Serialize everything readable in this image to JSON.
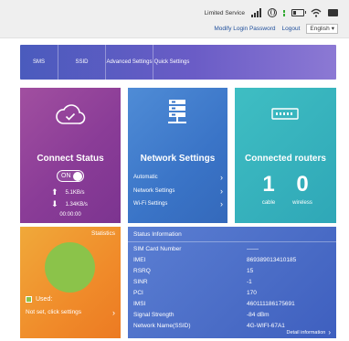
{
  "topbar": {
    "service_status": "Limited Service",
    "icons": [
      "signal-icon",
      "globe-icon",
      "battery-icon",
      "wifi-icon",
      "mail-icon"
    ],
    "modify_password": "Modify Login Password",
    "logout": "Logout",
    "language": "English"
  },
  "nav": {
    "items": [
      "SMS",
      "SSID",
      "Advanced Settings",
      "Quick Settings"
    ]
  },
  "connect": {
    "title": "Connect Status",
    "toggle_label": "ON",
    "toggle_on": true,
    "upload_rate": "5.1KB/s",
    "download_rate": "1.34KB/s",
    "uptime": "00:00:00"
  },
  "network": {
    "title": "Network Settings",
    "links": [
      "Automatic",
      "Network Settings",
      "Wi-Fi Settings"
    ]
  },
  "routers": {
    "title": "Connected routers",
    "cable_count": "1",
    "cable_label": "cable",
    "wireless_count": "0",
    "wireless_label": "wireless"
  },
  "statistics": {
    "title": "Statistics",
    "used_label": "Used:",
    "not_set_text": "Not set, click settings"
  },
  "status_info": {
    "title": "Status Information",
    "rows": [
      {
        "key": "SIM Card Number",
        "value": "——"
      },
      {
        "key": "IMEI",
        "value": "869389013410185"
      },
      {
        "key": "RSRQ",
        "value": "15"
      },
      {
        "key": "SINR",
        "value": "-1"
      },
      {
        "key": "PCI",
        "value": "170"
      },
      {
        "key": "IMSI",
        "value": "460111186175691"
      },
      {
        "key": "Signal Strength",
        "value": "-84 dBm"
      },
      {
        "key": "Network Name(SSID)",
        "value": "4G-WIFI-67A1"
      }
    ],
    "detail_link": "Detail information"
  },
  "colors": {
    "connect_card": "#8a3c97",
    "network_card": "#3a74c7",
    "routers_card": "#2fa7b7",
    "stats_card": "#f08b2a",
    "status_info_card": "#4a6cc6",
    "nav_bar": "#5a5cc2",
    "pie_used": "#8bc34a"
  }
}
